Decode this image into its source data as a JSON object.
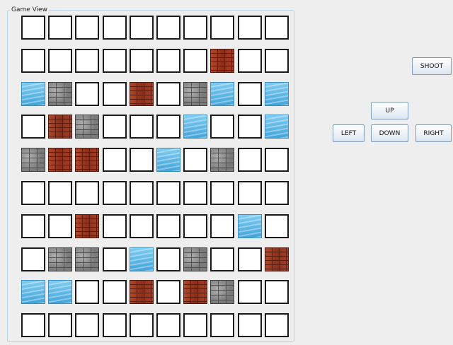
{
  "panel": {
    "title": "Game View"
  },
  "controls": {
    "shoot": "SHOOT",
    "up": "UP",
    "left": "LEFT",
    "down": "DOWN",
    "right": "RIGHT"
  },
  "legend": {
    "E": "empty",
    "B": "brick",
    "S": "stone",
    "W": "water"
  },
  "board": [
    [
      "E",
      "E",
      "E",
      "E",
      "E",
      "E",
      "E",
      "E",
      "E",
      "E"
    ],
    [
      "E",
      "E",
      "E",
      "E",
      "E",
      "E",
      "E",
      "B",
      "E",
      "E"
    ],
    [
      "W",
      "S",
      "E",
      "E",
      "B",
      "E",
      "S",
      "W",
      "E",
      "W"
    ],
    [
      "E",
      "B",
      "S",
      "E",
      "E",
      "E",
      "W",
      "E",
      "E",
      "W"
    ],
    [
      "S",
      "B",
      "B",
      "E",
      "E",
      "W",
      "E",
      "S",
      "E",
      "E"
    ],
    [
      "E",
      "E",
      "E",
      "E",
      "E",
      "E",
      "E",
      "E",
      "E",
      "E"
    ],
    [
      "E",
      "E",
      "B",
      "E",
      "E",
      "E",
      "E",
      "E",
      "W",
      "E"
    ],
    [
      "E",
      "S",
      "S",
      "E",
      "W",
      "E",
      "S",
      "E",
      "E",
      "B"
    ],
    [
      "W",
      "W",
      "E",
      "E",
      "B",
      "E",
      "B",
      "S",
      "E",
      "E"
    ],
    [
      "E",
      "E",
      "E",
      "E",
      "E",
      "E",
      "E",
      "E",
      "E",
      "E"
    ]
  ]
}
